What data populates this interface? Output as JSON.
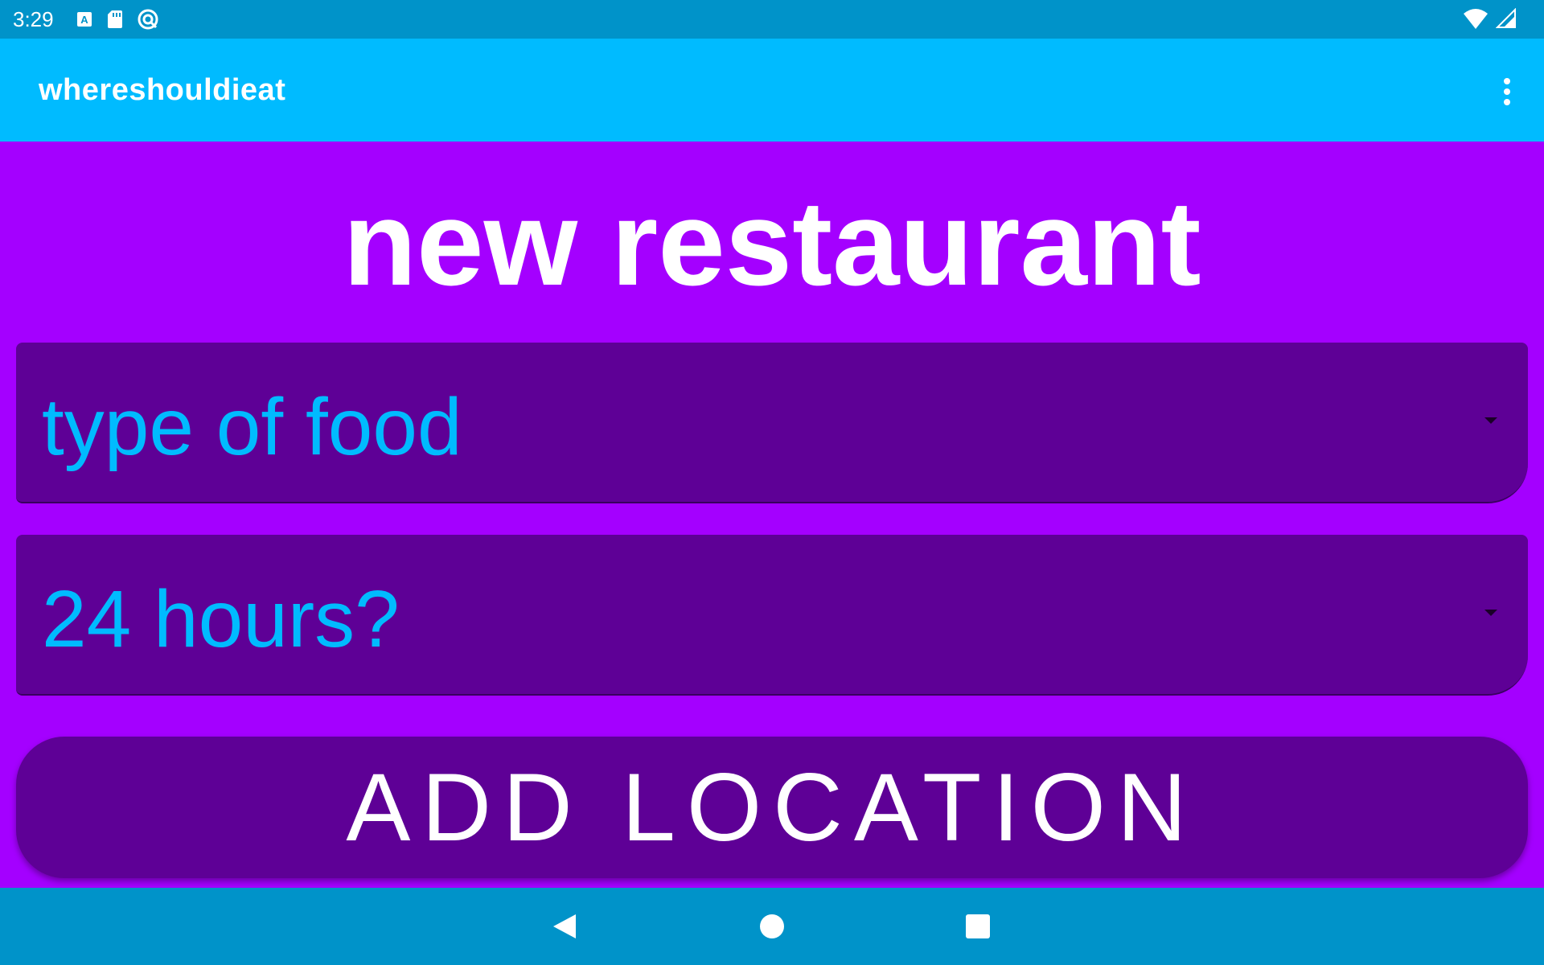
{
  "status_bar": {
    "time": "3:29",
    "left_icons": [
      "text-format-icon",
      "sd-card-icon",
      "do-not-disturb-icon"
    ],
    "right_icons": [
      "wifi-icon",
      "cellular-signal-icon"
    ]
  },
  "app_bar": {
    "title": "whereshouldieat",
    "menu_icon": "more-vert-icon"
  },
  "main": {
    "title": "new restaurant",
    "food_type_dropdown": {
      "value": "type of food",
      "icon": "dropdown-arrow-icon"
    },
    "hours_dropdown": {
      "value": "24 hours?",
      "icon": "dropdown-arrow-icon"
    },
    "add_button_label": "ADD LOCATION"
  },
  "nav_bar": {
    "icons": [
      "back-icon",
      "home-icon",
      "recents-icon"
    ]
  },
  "colors": {
    "status_bar": "#0093c9",
    "app_bar": "#00bbff",
    "background": "#a400ff",
    "control": "#5e0096",
    "dropdown_text": "#00bbff",
    "text": "#ffffff"
  }
}
